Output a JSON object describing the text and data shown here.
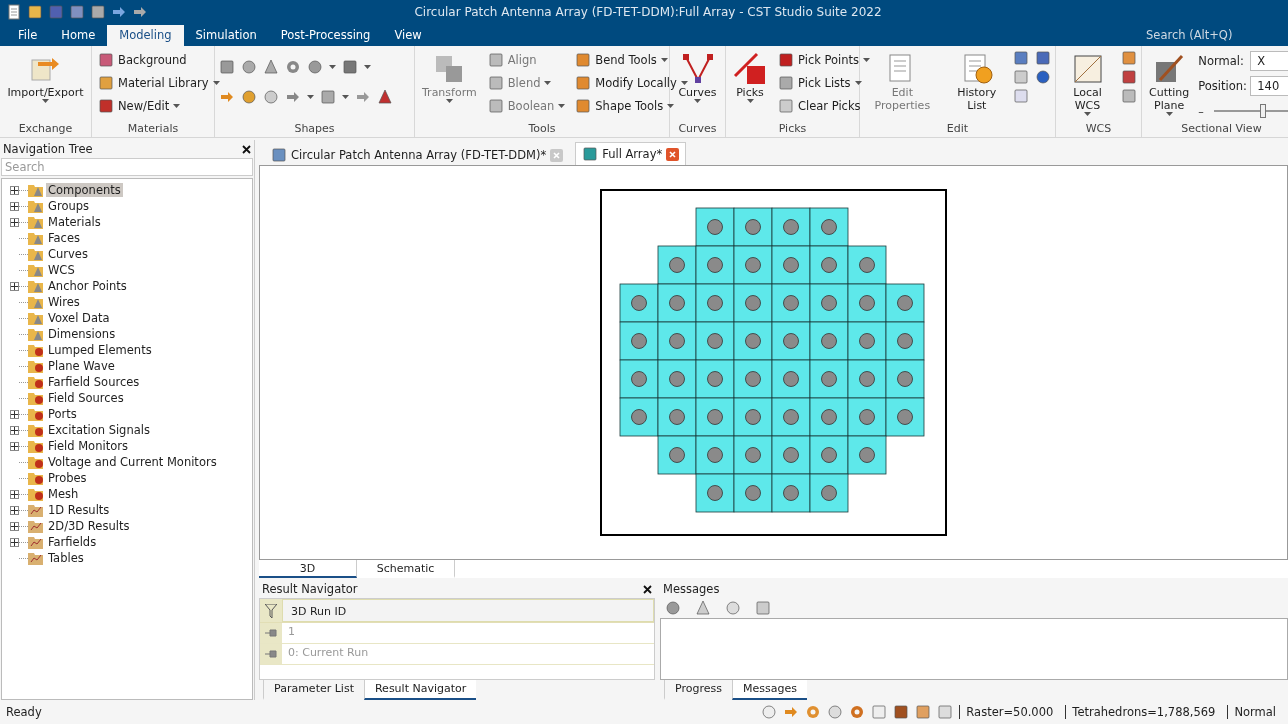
{
  "window": {
    "title": "Circular Patch Antenna Array (FD-TET-DDM):Full Array - CST Studio Suite 2022",
    "search": {
      "placeholder": "Search (Alt+Q)"
    }
  },
  "menu_tabs": [
    {
      "label": "File",
      "selected": false
    },
    {
      "label": "Home",
      "selected": false
    },
    {
      "label": "Modeling",
      "selected": true
    },
    {
      "label": "Simulation",
      "selected": false
    },
    {
      "label": "Post-Processing",
      "selected": false
    },
    {
      "label": "View",
      "selected": false
    }
  ],
  "ribbon": {
    "exchange": {
      "title": "Exchange",
      "button": {
        "label": "Import/Export",
        "dropdown": true
      }
    },
    "materials": {
      "title": "Materials",
      "items": [
        {
          "label": "Background",
          "dropdown": false
        },
        {
          "label": "Material Library",
          "dropdown": true
        },
        {
          "label": "New/Edit",
          "dropdown": true
        }
      ]
    },
    "shapes": {
      "title": "Shapes"
    },
    "tools": {
      "title": "Tools",
      "large": {
        "label": "Transform",
        "dropdown": true,
        "disabled": true
      },
      "items": [
        {
          "label": "Align",
          "dropdown": false,
          "disabled": true
        },
        {
          "label": "Blend",
          "dropdown": true,
          "disabled": true
        },
        {
          "label": "Boolean",
          "dropdown": true,
          "disabled": true
        },
        {
          "label": "Bend Tools",
          "dropdown": true,
          "disabled": false
        },
        {
          "label": "Modify Locally",
          "dropdown": true,
          "disabled": false
        },
        {
          "label": "Shape Tools",
          "dropdown": true,
          "disabled": false
        }
      ]
    },
    "curves": {
      "title": "Curves",
      "button": {
        "label": "Curves",
        "dropdown": true
      }
    },
    "picks": {
      "title": "Picks",
      "button": {
        "label": "Picks",
        "dropdown": true
      },
      "items": [
        {
          "label": "Pick Points",
          "dropdown": true
        },
        {
          "label": "Pick Lists",
          "dropdown": true
        },
        {
          "label": "Clear Picks",
          "dropdown": false
        }
      ]
    },
    "edit": {
      "title": "Edit",
      "buttons": [
        {
          "label": "Edit Properties",
          "disabled": true
        },
        {
          "label": "History List",
          "disabled": false
        }
      ]
    },
    "wcs": {
      "title": "WCS",
      "button": {
        "label": "Local WCS",
        "dropdown": true
      }
    },
    "sectional": {
      "title": "Sectional View",
      "button": {
        "label": "Cutting Plane",
        "dropdown": true
      },
      "normal": {
        "label": "Normal:",
        "value": "X"
      },
      "position": {
        "label": "Position:",
        "value": "140"
      },
      "slider": {
        "label": "–",
        "level": 0.62
      }
    }
  },
  "navigation": {
    "title": "Navigation Tree",
    "search": {
      "placeholder": "Search"
    },
    "items": [
      {
        "label": "Components",
        "kind": "model",
        "expandable": true,
        "selected": true
      },
      {
        "label": "Groups",
        "kind": "model",
        "expandable": true,
        "selected": false
      },
      {
        "label": "Materials",
        "kind": "model",
        "expandable": true,
        "selected": false
      },
      {
        "label": "Faces",
        "kind": "model",
        "expandable": false,
        "selected": false
      },
      {
        "label": "Curves",
        "kind": "model",
        "expandable": false,
        "selected": false
      },
      {
        "label": "WCS",
        "kind": "model",
        "expandable": false,
        "selected": false
      },
      {
        "label": "Anchor Points",
        "kind": "model",
        "expandable": true,
        "selected": false
      },
      {
        "label": "Wires",
        "kind": "model",
        "expandable": false,
        "selected": false
      },
      {
        "label": "Voxel Data",
        "kind": "model",
        "expandable": false,
        "selected": false
      },
      {
        "label": "Dimensions",
        "kind": "model",
        "expandable": false,
        "selected": false
      },
      {
        "label": "Lumped Elements",
        "kind": "solver",
        "expandable": false,
        "selected": false
      },
      {
        "label": "Plane Wave",
        "kind": "solver",
        "expandable": false,
        "selected": false
      },
      {
        "label": "Farfield Sources",
        "kind": "solver",
        "expandable": false,
        "selected": false
      },
      {
        "label": "Field Sources",
        "kind": "solver",
        "expandable": false,
        "selected": false
      },
      {
        "label": "Ports",
        "kind": "solver",
        "expandable": true,
        "selected": false
      },
      {
        "label": "Excitation Signals",
        "kind": "solver",
        "expandable": true,
        "selected": false
      },
      {
        "label": "Field Monitors",
        "kind": "solver",
        "expandable": true,
        "selected": false
      },
      {
        "label": "Voltage and Current Monitors",
        "kind": "solver",
        "expandable": false,
        "selected": false
      },
      {
        "label": "Probes",
        "kind": "solver",
        "expandable": false,
        "selected": false
      },
      {
        "label": "Mesh",
        "kind": "solver",
        "expandable": true,
        "selected": false
      },
      {
        "label": "1D Results",
        "kind": "result",
        "expandable": true,
        "selected": false
      },
      {
        "label": "2D/3D Results",
        "kind": "result",
        "expandable": true,
        "selected": false
      },
      {
        "label": "Farfields",
        "kind": "result",
        "expandable": true,
        "selected": false
      },
      {
        "label": "Tables",
        "kind": "result",
        "expandable": false,
        "selected": false
      }
    ]
  },
  "document_tabs": [
    {
      "label": "Circular Patch Antenna Array (FD-TET-DDM)*",
      "selected": false
    },
    {
      "label": "Full Array*",
      "selected": true
    }
  ],
  "view_tabs": [
    {
      "label": "3D",
      "selected": true
    },
    {
      "label": "Schematic",
      "selected": false
    }
  ],
  "result_navigator": {
    "title": "Result Navigator",
    "column": "3D Run ID",
    "rows": [
      "1",
      "0: Current Run"
    ]
  },
  "left_tabs": [
    {
      "label": "Parameter List",
      "selected": false
    },
    {
      "label": "Result Navigator",
      "selected": true
    }
  ],
  "messages": {
    "title": "Messages"
  },
  "right_tabs": [
    {
      "label": "Progress",
      "selected": false
    },
    {
      "label": "Messages",
      "selected": true
    }
  ],
  "status_bar": {
    "text": "Ready",
    "fields": [
      "Raster=50.000",
      "Tetrahedrons=1,788,569",
      "Normal"
    ]
  }
}
